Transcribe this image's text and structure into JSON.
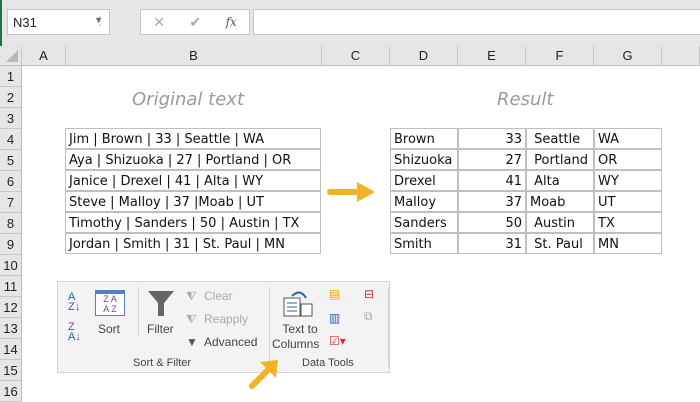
{
  "formula_bar": {
    "name_box": "N31",
    "cancel": "✕",
    "enter": "✔",
    "fx": "fx",
    "formula": ""
  },
  "columns": [
    "A",
    "B",
    "C",
    "D",
    "E",
    "F",
    "G"
  ],
  "rows": [
    "1",
    "2",
    "3",
    "4",
    "5",
    "6",
    "7",
    "8",
    "9",
    "10",
    "11",
    "12",
    "13",
    "14",
    "15",
    "16"
  ],
  "original": {
    "title": "Original text",
    "lines": [
      "Jim | Brown | 33 | Seattle | WA",
      "Aya | Shizuoka | 27 | Portland | OR",
      "Janice | Drexel | 41 | Alta | WY",
      "Steve | Malloy | 37 |Moab | UT",
      "Timothy | Sanders | 50 | Austin | TX",
      "Jordan | Smith | 31 | St. Paul | MN"
    ]
  },
  "result": {
    "title": "Result",
    "rows": [
      [
        "Brown",
        "33",
        " Seattle",
        "WA"
      ],
      [
        "Shizuoka",
        "27",
        " Portland",
        "OR"
      ],
      [
        "Drexel",
        "41",
        " Alta",
        "WY"
      ],
      [
        "Malloy",
        "37",
        "Moab",
        "UT"
      ],
      [
        "Sanders",
        "50",
        " Austin",
        "TX"
      ],
      [
        "Smith",
        "31",
        " St. Paul",
        "MN"
      ]
    ]
  },
  "ribbon": {
    "sort": "Sort",
    "filter": "Filter",
    "clear": "Clear",
    "reapply": "Reapply",
    "advanced": "Advanced",
    "sort_filter_group": "Sort & Filter",
    "text_to": "Text to",
    "columns": "Columns",
    "data_tools_group": "Data Tools"
  },
  "accent": "#f0b323"
}
